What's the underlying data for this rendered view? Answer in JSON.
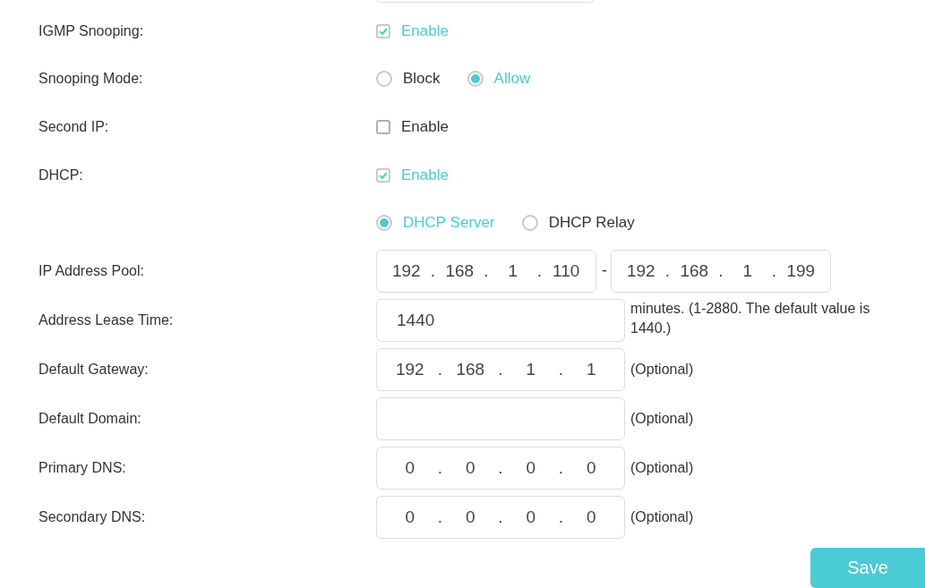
{
  "rows": [
    {
      "label": "IGMP Snooping:",
      "kind": "checkbox",
      "option": {
        "label": "Enable",
        "checked": true
      }
    },
    {
      "label": "Snooping Mode:",
      "kind": "radio",
      "options": [
        {
          "label": "Block",
          "selected": false
        },
        {
          "label": "Allow",
          "selected": true
        }
      ]
    },
    {
      "label": "Second IP:",
      "kind": "checkbox",
      "option": {
        "label": "Enable",
        "checked": false
      }
    },
    {
      "label": "DHCP:",
      "kind": "checkbox",
      "option": {
        "label": "Enable",
        "checked": true
      }
    },
    {
      "kind": "radio",
      "options": [
        {
          "label": "DHCP Server",
          "selected": true
        },
        {
          "label": "DHCP Relay",
          "selected": false
        }
      ]
    },
    {
      "label": "IP Address Pool:",
      "kind": "ip_range",
      "from": [
        "192",
        ".",
        "168",
        ".",
        "1",
        ".",
        "110"
      ],
      "separator": "-",
      "to": [
        "192",
        ".",
        "168",
        ".",
        "1",
        ".",
        "199"
      ]
    },
    {
      "label": "Address Lease Time:",
      "kind": "text",
      "value": "1440",
      "note": "minutes. (1-2880. The default value is 1440.)"
    },
    {
      "label": "Default Gateway:",
      "kind": "ip",
      "parts": [
        "192",
        ".",
        "168",
        ".",
        "1",
        ".",
        "1"
      ],
      "note": "(Optional)"
    },
    {
      "label": "Default Domain:",
      "kind": "text",
      "note": "(Optional)"
    },
    {
      "label": "Primary DNS:",
      "kind": "ip",
      "parts": [
        "0",
        ".",
        "0",
        ".",
        "0",
        ".",
        "0"
      ],
      "note": "(Optional)"
    },
    {
      "label": "Secondary DNS:",
      "kind": "ip",
      "parts": [
        "0",
        ".",
        "0",
        ".",
        "0",
        ".",
        "0"
      ],
      "note": "(Optional)"
    }
  ],
  "save_button": "Save"
}
